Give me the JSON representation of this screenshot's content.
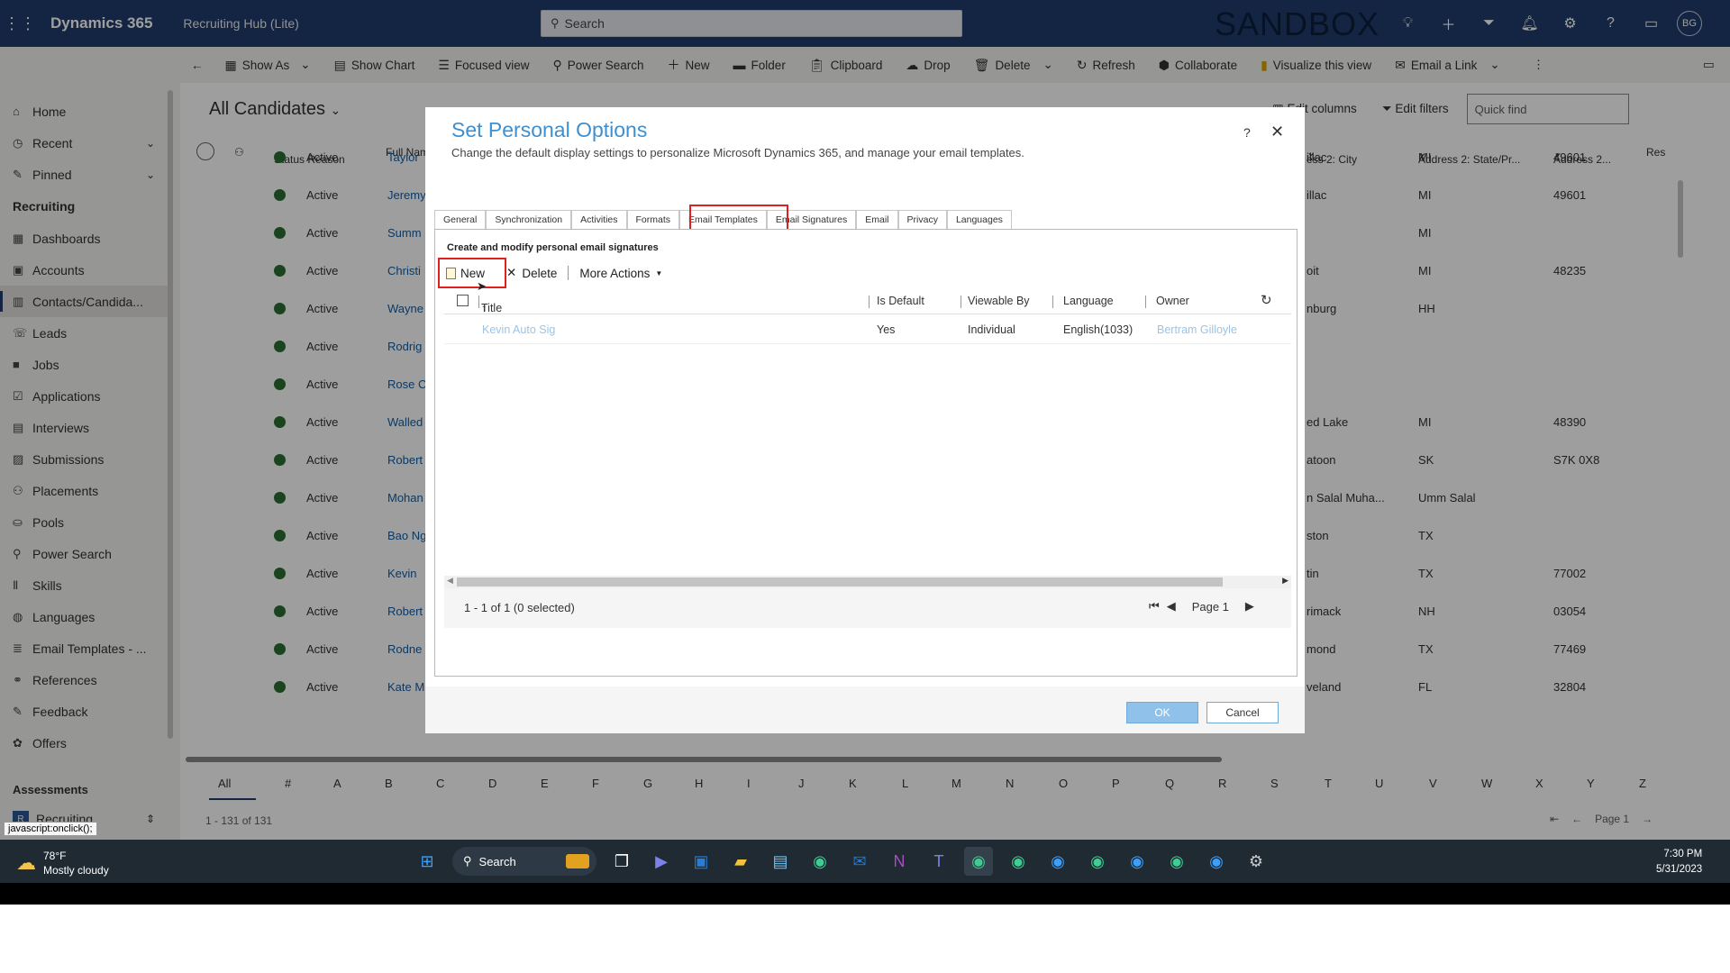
{
  "topbar": {
    "brand": "Dynamics 365",
    "app_name": "Recruiting Hub (Lite)",
    "search_placeholder": "Search",
    "environment": "SANDBOX",
    "user_initials": "BG",
    "icons": [
      "lightbulb-icon",
      "plus-icon",
      "filter-icon",
      "bell-icon",
      "gear-icon",
      "help-icon",
      "chat-icon"
    ]
  },
  "commandbar": {
    "items": [
      "Show As",
      "Show Chart",
      "Focused view",
      "Power Search",
      "New",
      "Folder",
      "Clipboard",
      "Drop",
      "Delete",
      "Refresh",
      "Collaborate",
      "Visualize this view",
      "Email a Link"
    ]
  },
  "sidebar": {
    "top": [
      {
        "label": "Home",
        "icon": "home-icon"
      },
      {
        "label": "Recent",
        "icon": "clock-icon"
      },
      {
        "label": "Pinned",
        "icon": "pin-icon"
      }
    ],
    "group": "Recruiting",
    "items": [
      {
        "label": "Dashboards",
        "icon": "dashboard-icon"
      },
      {
        "label": "Accounts",
        "icon": "building-icon"
      },
      {
        "label": "Contacts/Candida...",
        "icon": "contacts-icon"
      },
      {
        "label": "Leads",
        "icon": "phone-icon"
      },
      {
        "label": "Jobs",
        "icon": "briefcase-icon"
      },
      {
        "label": "Applications",
        "icon": "checkbox-icon"
      },
      {
        "label": "Interviews",
        "icon": "calendar-icon"
      },
      {
        "label": "Submissions",
        "icon": "inbox-icon"
      },
      {
        "label": "Placements",
        "icon": "people-icon"
      },
      {
        "label": "Pools",
        "icon": "pool-icon"
      },
      {
        "label": "Power Search",
        "icon": "search-icon"
      },
      {
        "label": "Skills",
        "icon": "skills-icon"
      },
      {
        "label": "Languages",
        "icon": "globe-icon"
      },
      {
        "label": "Email Templates - ...",
        "icon": "stack-icon"
      },
      {
        "label": "References",
        "icon": "references-icon"
      },
      {
        "label": "Feedback",
        "icon": "feedback-icon"
      },
      {
        "label": "Offers",
        "icon": "offers-icon"
      }
    ],
    "group2": "Assessments",
    "area_switcher": "Recruiting"
  },
  "main": {
    "view_title": "All Candidates",
    "edit_columns": "Edit columns",
    "edit_filters": "Edit filters",
    "quick_find": "Quick find",
    "headers": {
      "status": "Status Reason",
      "name": "Full Nam",
      "city": "ess 2: City",
      "state": "Address 2: State/Pr...",
      "zip": "Address 2...",
      "res": "Res"
    },
    "rows": [
      {
        "status": "Active",
        "name": "Taylor",
        "city": "illac",
        "state": "MI",
        "zip": "49601"
      },
      {
        "status": "Active",
        "name": "Jeremy",
        "city": "illac",
        "state": "MI",
        "zip": "49601"
      },
      {
        "status": "Active",
        "name": "Summ",
        "city": "",
        "state": "MI",
        "zip": ""
      },
      {
        "status": "Active",
        "name": "Christi",
        "city": "oit",
        "state": "MI",
        "zip": "48235"
      },
      {
        "status": "Active",
        "name": "Wayne",
        "city": "nburg",
        "state": "HH",
        "zip": ""
      },
      {
        "status": "Active",
        "name": "Rodrig",
        "city": "",
        "state": "",
        "zip": ""
      },
      {
        "status": "Active",
        "name": "Rose C",
        "city": "",
        "state": "",
        "zip": ""
      },
      {
        "status": "Active",
        "name": "Walled",
        "city": "ed Lake",
        "state": "MI",
        "zip": "48390"
      },
      {
        "status": "Active",
        "name": "Robert",
        "city": "atoon",
        "state": "SK",
        "zip": "S7K 0X8"
      },
      {
        "status": "Active",
        "name": "Mohan",
        "city": "n Salal Muha...",
        "state": "Umm Salal",
        "zip": ""
      },
      {
        "status": "Active",
        "name": "Bao Ng",
        "city": "ston",
        "state": "TX",
        "zip": ""
      },
      {
        "status": "Active",
        "name": "Kevin",
        "city": "tin",
        "state": "TX",
        "zip": "77002"
      },
      {
        "status": "Active",
        "name": "Robert",
        "city": "rimack",
        "state": "NH",
        "zip": "03054"
      },
      {
        "status": "Active",
        "name": "Rodne",
        "city": "mond",
        "state": "TX",
        "zip": "77469"
      },
      {
        "status": "Active",
        "name": "Kate M",
        "city": "veland",
        "state": "FL",
        "zip": "32804"
      }
    ],
    "alphabet": [
      "All",
      "#",
      "A",
      "B",
      "C",
      "D",
      "E",
      "F",
      "G",
      "H",
      "I",
      "J",
      "K",
      "L",
      "M",
      "N",
      "O",
      "P",
      "Q",
      "R",
      "S",
      "T",
      "U",
      "V",
      "W",
      "X",
      "Y",
      "Z"
    ],
    "record_count": "1 - 131 of 131",
    "page": "Page 1"
  },
  "dialog": {
    "title": "Set Personal Options",
    "subtitle": "Change the default display settings to personalize Microsoft Dynamics 365, and manage your email templates.",
    "help": "?",
    "tabs": [
      "General",
      "Synchronization",
      "Activities",
      "Formats",
      "Email Templates",
      "Email Signatures",
      "Email",
      "Privacy",
      "Languages"
    ],
    "selected_tab": "Email Templates",
    "caption": "Create and modify personal email signatures",
    "toolbar": {
      "new": "New",
      "delete": "Delete",
      "more": "More Actions"
    },
    "columns": {
      "title": "Title",
      "is_default": "Is Default",
      "viewable_by": "Viewable By",
      "language": "Language",
      "owner": "Owner"
    },
    "rows": [
      {
        "title": "Kevin Auto Sig",
        "is_default": "Yes",
        "viewable_by": "Individual",
        "language": "English(1033)",
        "owner": "Bertram Gilloyle"
      }
    ],
    "status": "1 - 1 of 1 (0 selected)",
    "page": "Page 1",
    "ok": "OK",
    "cancel": "Cancel"
  },
  "tooltip": "javascript:onclick();",
  "taskbar": {
    "temperature": "78°F",
    "weather": "Mostly cloudy",
    "search": "Search",
    "time": "7:30 PM",
    "date": "5/31/2023"
  },
  "colors": {
    "accent": "#1f3d6b",
    "dialog_title": "#3e8fcf",
    "highlight": "#e02020",
    "active_dot": "#2a6e2f"
  }
}
